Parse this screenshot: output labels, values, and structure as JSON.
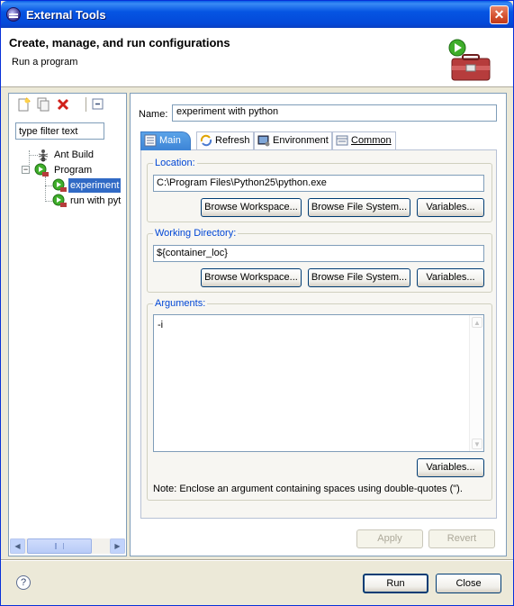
{
  "window": {
    "title": "External Tools"
  },
  "banner": {
    "title": "Create, manage, and run configurations",
    "subtitle": "Run a program"
  },
  "tree": {
    "filter_placeholder": "type filter text",
    "items": [
      {
        "label": "Ant Build"
      },
      {
        "label": "Program"
      },
      {
        "label": "experiment"
      },
      {
        "label": "run with pyt"
      }
    ]
  },
  "config": {
    "name_label": "Name:",
    "name_value": "experiment with python",
    "tabs": [
      {
        "label": "Main"
      },
      {
        "label": "Refresh"
      },
      {
        "label": "Environment"
      },
      {
        "label": "Common"
      }
    ],
    "location": {
      "label": "Location:",
      "value": "C:\\Program Files\\Python25\\python.exe",
      "btn_workspace": "Browse Workspace...",
      "btn_filesystem": "Browse File System...",
      "btn_variables": "Variables..."
    },
    "working_dir": {
      "label": "Working Directory:",
      "value": "${container_loc}",
      "btn_workspace": "Browse Workspace...",
      "btn_filesystem": "Browse File System...",
      "btn_variables": "Variables..."
    },
    "arguments": {
      "label": "Arguments:",
      "value": "-i",
      "btn_variables": "Variables...",
      "note": "Note: Enclose an argument containing spaces using double-quotes (\")."
    },
    "apply": "Apply",
    "revert": "Revert"
  },
  "footer": {
    "run": "Run",
    "close": "Close"
  }
}
